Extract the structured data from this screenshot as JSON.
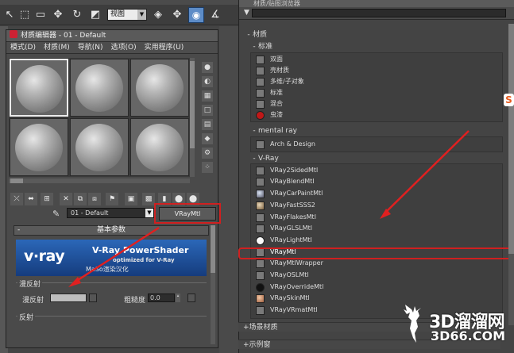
{
  "toolbar": {
    "view_select": "视图",
    "icons": [
      "select-icon",
      "region-select-icon",
      "move-icon",
      "rotate-icon",
      "scale-icon",
      "reference-coord-icon",
      "pivot-icon",
      "snap-icon"
    ]
  },
  "material_editor": {
    "title": "材质编辑器 - 01 - Default",
    "menu": [
      "模式(D)",
      "材质(M)",
      "导航(N)",
      "选项(O)",
      "实用程序(U)"
    ],
    "slot_count": 6,
    "material_name": "01 - Default",
    "material_type": "VRayMtl",
    "rollout_title": "基本参数",
    "banner": {
      "logo": "v·ray",
      "title": "V-Ray PowerShader",
      "subtitle": "optimized for V-Ray",
      "cn": "MaSo渲染汉化"
    },
    "diffuse_group": "漫反射",
    "diffuse_label": "漫反射",
    "roughness_label": "粗糙度",
    "roughness_value": "0.0",
    "reflection_group": "反射"
  },
  "browser": {
    "title": "材质/贴图浏览器",
    "sections": {
      "materials": "材质",
      "standard": "标准",
      "mental_ray": "mental ray",
      "vray": "V-Ray",
      "scene_materials": "场景材质",
      "samples": "示例窗"
    },
    "standard_items": [
      "双面",
      "壳材质",
      "多维/子对象",
      "标准",
      "混合",
      "虫漆"
    ],
    "mental_ray_items": [
      "Arch & Design"
    ],
    "vray_items": [
      "VRay2SidedMtl",
      "VRayBlendMtl",
      "VRayCarPaintMtl",
      "VRayFastSSS2",
      "VRayFlakesMtl",
      "VRayGLSLMtl",
      "VRayLightMtl",
      "VRayMtl",
      "VRayMtlWrapper",
      "VRayOSLMtl",
      "VRayOverrideMtl",
      "VRaySkinMtl",
      "VRayVRmatMtl"
    ],
    "selected_item": "VRayMtl"
  },
  "watermark": {
    "brand": "3D溜溜网",
    "url": "3D66.COM"
  },
  "colors": {
    "highlight_red": "#d02020",
    "vray_blue": "#1e4a92",
    "snap_blue": "#5d8cc7"
  }
}
